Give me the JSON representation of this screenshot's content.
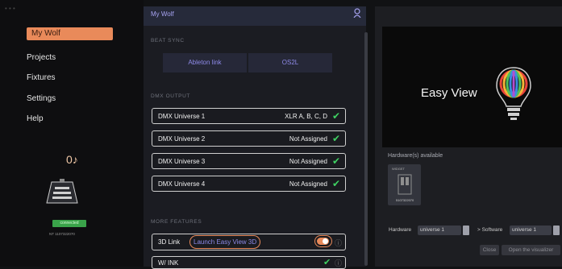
{
  "colors": {
    "accent": "#e98a5a",
    "check": "#3fd162",
    "link": "#8e8ae8",
    "connected": "#3aa34a"
  },
  "sidebar": {
    "items": [
      {
        "label": "My Wolf"
      },
      {
        "label": "Projects"
      },
      {
        "label": "Fixtures"
      },
      {
        "label": "Settings"
      },
      {
        "label": "Help"
      }
    ],
    "device": {
      "icon": "music-note-icon",
      "status": "connected",
      "serial": "NT 1107322070"
    }
  },
  "main": {
    "title": "My Wolf",
    "user_icon": "user-icon",
    "beat_sync": {
      "label": "BEAT SYNC",
      "buttons": [
        "Ableton link",
        "OS2L"
      ]
    },
    "dmx_output": {
      "label": "DMX OUTPUT",
      "universes": [
        {
          "name": "DMX Universe 1",
          "value": "XLR A, B, C, D"
        },
        {
          "name": "DMX Universe 2",
          "value": "Not Assigned"
        },
        {
          "name": "DMX Universe 3",
          "value": "Not Assigned"
        },
        {
          "name": "DMX Universe 4",
          "value": "Not Assigned"
        }
      ]
    },
    "more_features": {
      "label": "MORE FEATURES",
      "items": [
        {
          "name": "3D Link",
          "action": "Launch Easy View 3D",
          "toggle": true
        },
        {
          "name": "W/ INK"
        }
      ]
    }
  },
  "right_panel": {
    "logo_text": "Easy View",
    "hardware_label": "Hardware(s) available",
    "hardware_card_title": "WIDGET",
    "hardware_card_id": "5107322070",
    "hardware_field_label": "Hardware",
    "hardware_value": "universe 1",
    "software_field_label": "> Software",
    "software_value": "universe 1",
    "close_button": "Close",
    "open_button": "Open the visualizer"
  }
}
